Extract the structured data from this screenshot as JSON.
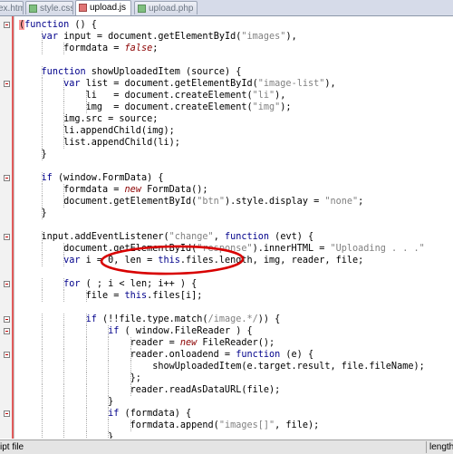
{
  "tabs": [
    {
      "label": "ex.html",
      "active": false,
      "modified": false
    },
    {
      "label": "style.css",
      "active": false,
      "modified": false
    },
    {
      "label": "upload.js",
      "active": true,
      "modified": true
    },
    {
      "label": "upload.php",
      "active": false,
      "modified": false
    }
  ],
  "editor": {
    "language": "javascript",
    "lines": [
      "(function () {",
      "    var input = document.getElementById(\"images\"),",
      "        formdata = false;",
      "",
      "    function showUploadedItem (source) {",
      "        var list = document.getElementById(\"image-list\"),",
      "            li   = document.createElement(\"li\"),",
      "            img  = document.createElement(\"img\");",
      "        img.src = source;",
      "        li.appendChild(img);",
      "        list.appendChild(li);",
      "    }",
      "",
      "    if (window.FormData) {",
      "        formdata = new FormData();",
      "        document.getElementById(\"btn\").style.display = \"none\";",
      "    }",
      "",
      "    input.addEventListener(\"change\", function (evt) {",
      "        document.getElementById(\"response\").innerHTML = \"Uploading . . .\"",
      "        var i = 0, len = this.files.length, img, reader, file;",
      "",
      "        for ( ; i < len; i++ ) {",
      "            file = this.files[i];",
      "",
      "            if (!!file.type.match(/image.*/)) {",
      "                if ( window.FileReader ) {",
      "                    reader = new FileReader();",
      "                    reader.onloadend = function (e) {",
      "                        showUploadedItem(e.target.result, file.fileName);",
      "                    };",
      "                    reader.readAsDataURL(file);",
      "                }",
      "                if (formdata) {",
      "                    formdata.append(\"images[]\", file);",
      "                }"
    ]
  },
  "status": {
    "file_type": "ipt file",
    "length_label": "length"
  },
  "colors": {
    "annotation_ellipse": "#d80000",
    "change_bar": "#e15b5b",
    "keyword": "#00008b",
    "string": "#808080",
    "literal": "#8b0000"
  }
}
